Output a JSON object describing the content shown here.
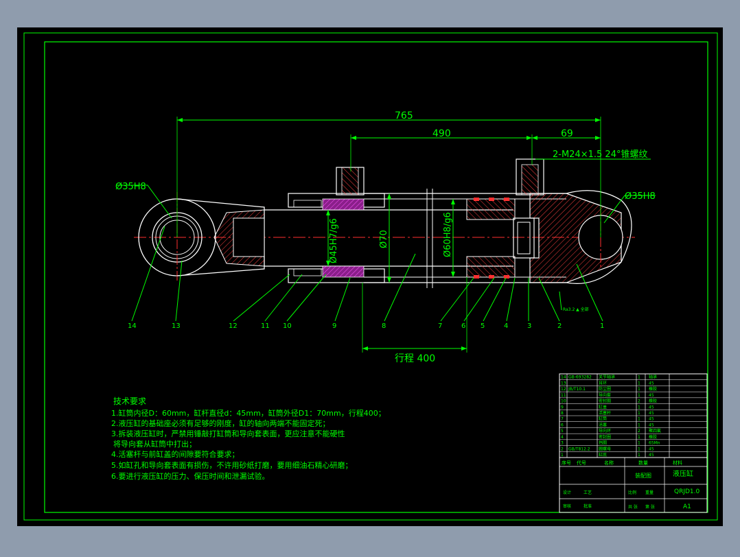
{
  "dimensions": {
    "overall_length": "765",
    "stroke_span": "490",
    "end_span": "69",
    "thread_note": "2-M24×1.5 24°锥螺纹",
    "rod_end_bore": "Ø35H8",
    "cap_end_bore": "Ø35H8",
    "rod_diameter": "Ø45H7/g6",
    "outer_diameter": "Ø70",
    "bore_diameter": "Ø60H8/g6",
    "stroke": "行程 400"
  },
  "balloons": [
    "14",
    "13",
    "12",
    "11",
    "10",
    "9",
    "8",
    "7",
    "6",
    "5",
    "4",
    "3",
    "2",
    "1"
  ],
  "leader_note": "Ra3.2 ▲ 全部",
  "tech_requirements": {
    "title": "技术要求",
    "items": [
      "1.缸筒内径D：60mm，缸杆直径d：45mm，缸筒外径D1：70mm，行程400；",
      "2.液压缸的基础座必须有足够的刚度，缸的轴向两端不能固定死；",
      "3.拆装液压缸时，严禁用锤敲打缸筒和导向套表面，更应注意不能硬性",
      "将导向套从缸筒中打出；",
      "4.活塞杆与前缸盖的间隙要符合要求；",
      "5.如缸孔和导向套表面有损伤，不许用砂纸打磨，要用细油石精心研磨；",
      "6.要进行液压缸的压力、保压时间和泄漏试验。"
    ]
  },
  "title_block": {
    "drawing_title": "液压缸",
    "drawing_no": "QRJD1.0",
    "sheet": "A1",
    "material": "装配图",
    "parts": [
      {
        "no": "14",
        "code": "GB-693282",
        "name": "关节轴承",
        "qty": "1",
        "mat": "轴承"
      },
      {
        "no": "13",
        "code": "",
        "name": "耳环",
        "qty": "1",
        "mat": "45"
      },
      {
        "no": "12",
        "code": "JB/T10.1",
        "name": "防尘圈",
        "qty": "1",
        "mat": "橡胶"
      },
      {
        "no": "11",
        "code": "",
        "name": "导向套",
        "qty": "1",
        "mat": "45"
      },
      {
        "no": "10",
        "code": "",
        "name": "密封圈",
        "qty": "2",
        "mat": "橡胶"
      },
      {
        "no": "9",
        "code": "",
        "name": "缸盖",
        "qty": "1",
        "mat": "45"
      },
      {
        "no": "8",
        "code": "",
        "name": "活塞杆",
        "qty": "1",
        "mat": "45"
      },
      {
        "no": "7",
        "code": "",
        "name": "缸筒",
        "qty": "1",
        "mat": "45"
      },
      {
        "no": "6",
        "code": "",
        "name": "活塞",
        "qty": "1",
        "mat": "45"
      },
      {
        "no": "5",
        "code": "",
        "name": "导向环",
        "qty": "2",
        "mat": "聚四氟"
      },
      {
        "no": "4",
        "code": "",
        "name": "密封圈",
        "qty": "1",
        "mat": "橡胶"
      },
      {
        "no": "3",
        "code": "",
        "name": "挡圈",
        "qty": "1",
        "mat": "65Mn"
      },
      {
        "no": "2",
        "code": "GB/T812.2",
        "name": "圆螺母",
        "qty": "1",
        "mat": "45"
      },
      {
        "no": "1",
        "code": "",
        "name": "缸底",
        "qty": "1",
        "mat": "45"
      }
    ],
    "header": [
      "序号",
      "代号",
      "名称",
      "数量",
      "材料"
    ],
    "labels": [
      "设计",
      "审核",
      "工艺",
      "批准",
      "比例",
      "重量",
      "共 张",
      "第 张"
    ]
  },
  "colors": {
    "background": "#000000",
    "page": "#8f9cad",
    "border": "#00ff00",
    "outline": "#ffffff",
    "dimension": "#00ff00",
    "centerline": "#ff3030",
    "section": "#ff5050",
    "seal": "#cc33cc"
  }
}
